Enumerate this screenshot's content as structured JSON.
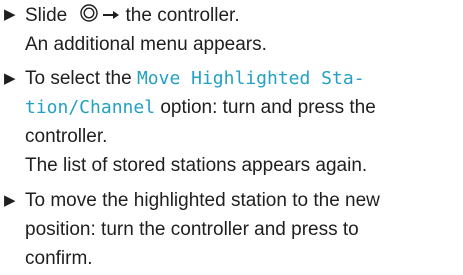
{
  "steps": [
    {
      "bullet": "▶",
      "line1_before": "Slide",
      "line1_after": "the controller.",
      "line2": "An additional menu appears."
    },
    {
      "bullet": "▶",
      "line1_before": "To select the",
      "highlight_part1": "Move Highlighted Sta-",
      "highlight_part2": "tion/Channel",
      "line2_after": "option: turn and press the",
      "line3": "controller.",
      "line4": "The list of stored stations appears again."
    },
    {
      "bullet": "▶",
      "line1": "To move the highlighted station to the new",
      "line2": "position: turn the controller and press to",
      "line3": "confirm."
    }
  ],
  "icons": {
    "controller": "controller-icon",
    "arrow": "arrow-right-icon"
  },
  "colors": {
    "text": "#1f1f1f",
    "highlight": "#23a0c4"
  }
}
